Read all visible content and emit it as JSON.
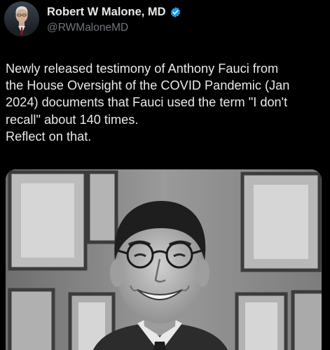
{
  "author": {
    "display_name": "Robert W Malone, MD",
    "handle": "@RWMaloneMD",
    "verified": true,
    "verified_color": "#1d9bf0"
  },
  "tweet": {
    "lines": [
      "Newly released testimony of Anthony Fauci from",
      "the House Oversight of the COVID Pandemic (Jan",
      "2024) documents that Fauci used the term \"I don't",
      "recall\" about 140 times.",
      "Reflect on that."
    ]
  },
  "media": {
    "type": "black-and-white photo",
    "subject": "portrait"
  },
  "colors": {
    "background": "#000000",
    "text_primary": "#e7e9ea",
    "text_secondary": "#71767b"
  }
}
